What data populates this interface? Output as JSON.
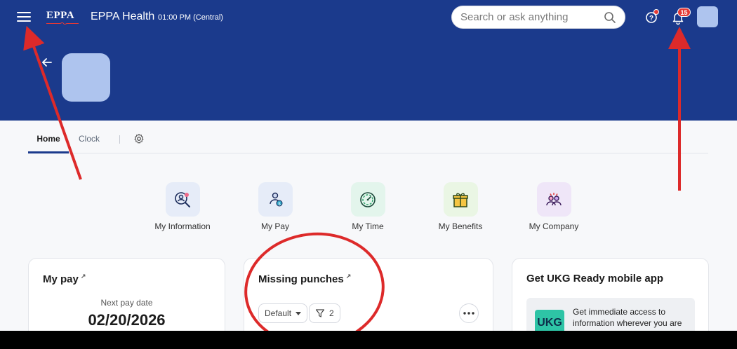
{
  "header": {
    "logo_text": "EPPA",
    "brand": "EPPA Health",
    "time": "01:00 PM (Central)",
    "search_placeholder": "Search or ask anything",
    "notification_count": "15",
    "header_color": "#1b3a8c"
  },
  "tabs": {
    "home": "Home",
    "clock": "Clock"
  },
  "quick_links": [
    {
      "label": "My Information",
      "icon": "person-search-icon",
      "bg": "#e6ecf8"
    },
    {
      "label": "My Pay",
      "icon": "pay-person-icon",
      "bg": "#e6ecf8"
    },
    {
      "label": "My Time",
      "icon": "stopwatch-icon",
      "bg": "#e3f5ec"
    },
    {
      "label": "My Benefits",
      "icon": "gift-icon",
      "bg": "#eaf6e4"
    },
    {
      "label": "My Company",
      "icon": "group-icon",
      "bg": "#efe6f8"
    }
  ],
  "cards": {
    "my_pay": {
      "title": "My pay",
      "next_pay_label": "Next pay date",
      "next_pay_date": "02/20/2026"
    },
    "missing_punches": {
      "title": "Missing punches",
      "view_select": "Default",
      "filter_count": "2"
    },
    "mobile_app": {
      "title": "Get UKG Ready mobile app",
      "logo": "UKG",
      "text": "Get immediate access to information wherever you are"
    }
  }
}
